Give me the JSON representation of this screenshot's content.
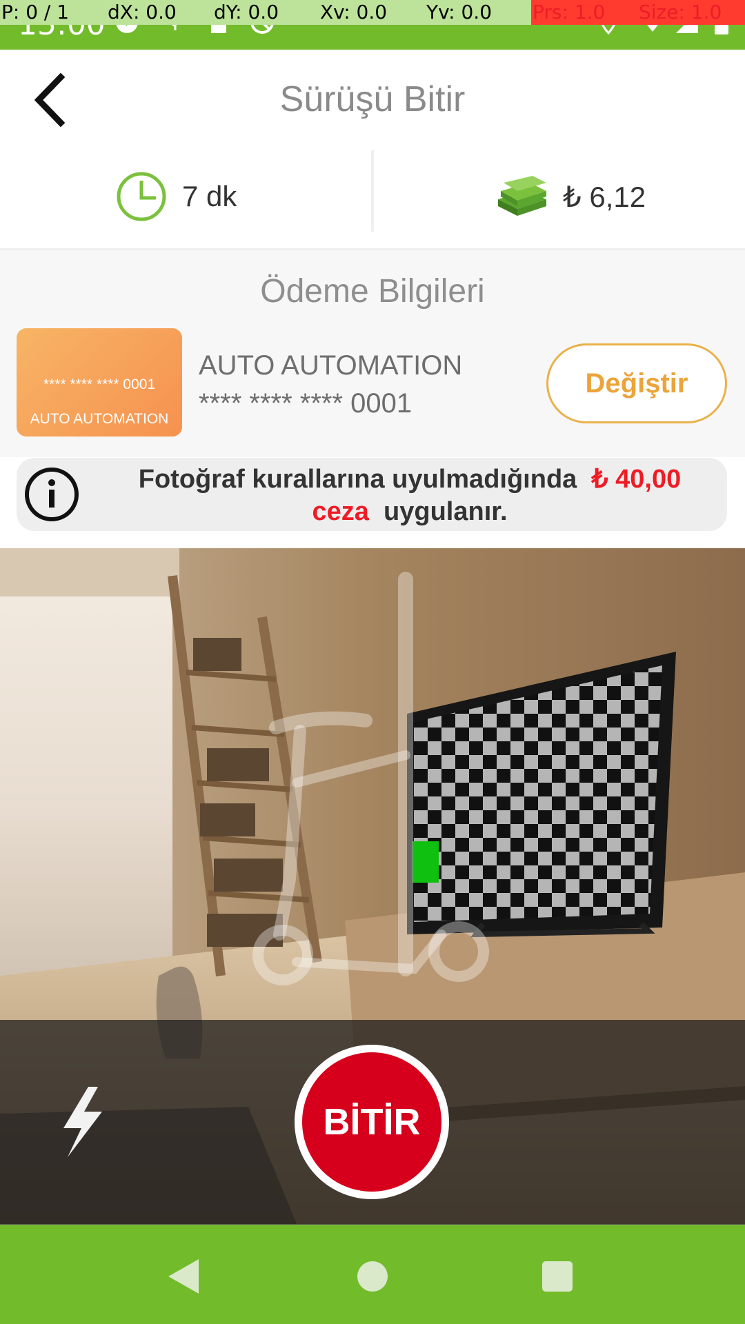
{
  "status_bar": {
    "time": "15:00",
    "debug": {
      "p": "P: 0 / 1",
      "dx": "dX: 0.0",
      "dy": "dY: 0.0",
      "xv": "Xv: 0.0",
      "yv": "Yv: 0.0",
      "prs": "Prs: 1.0",
      "size": "Size: 1.0"
    }
  },
  "header": {
    "title": "Sürüşü Bitir",
    "back_icon": "chevron-left-icon"
  },
  "summary": {
    "duration": "7 dk",
    "price": "₺ 6,12",
    "duration_icon": "clock-icon",
    "price_icon": "money-stack-icon"
  },
  "payment": {
    "title": "Ödeme Bilgileri",
    "card_thumb_number": "**** **** **** 0001",
    "card_thumb_name": "AUTO AUTOMATION",
    "card_holder": "AUTO AUTOMATION",
    "card_number": "**** **** **** 0001",
    "change_label": "Değiştir"
  },
  "warning": {
    "text_1": "Fotoğraf kurallarına uyulmadığında",
    "amount": "₺ 40,00",
    "penalty_word": "ceza",
    "text_2": "uygulanır."
  },
  "camera": {
    "finish_label": "BİTİR",
    "flash_icon": "flash-icon"
  },
  "colors": {
    "brand_green": "#72bb2b",
    "accent_orange": "#eca43a",
    "finish_red": "#d6001c",
    "warning_red": "#ee1c25"
  }
}
